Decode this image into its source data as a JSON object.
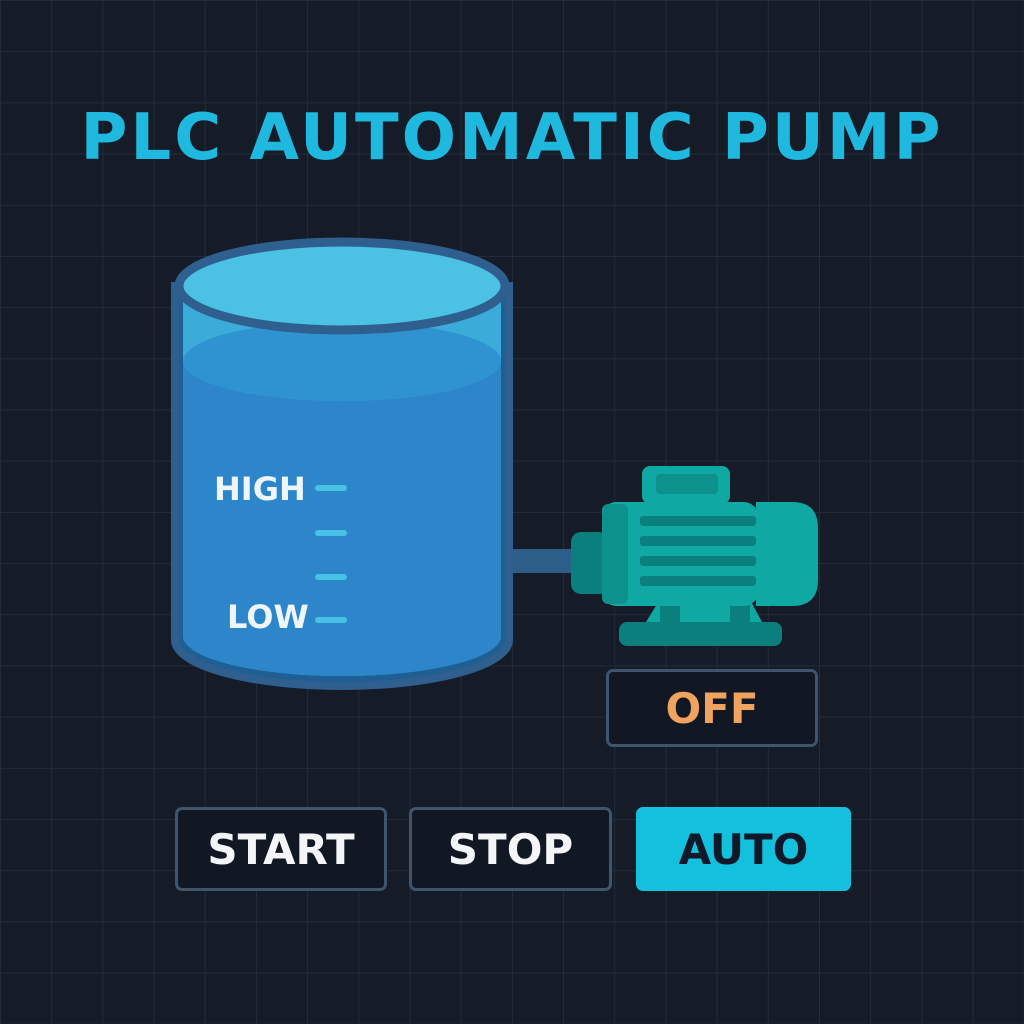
{
  "header": {
    "title": "PLC AUTOMATIC PUMP"
  },
  "tank": {
    "high_label": "HIGH",
    "low_label": "LOW",
    "level": 0.82
  },
  "pump": {
    "status": "OFF"
  },
  "controls": {
    "start_label": "START",
    "stop_label": "STOP",
    "auto_label": "AUTO",
    "active_mode": "auto"
  },
  "colors": {
    "background": "#151b27",
    "grid": "#232c3b",
    "title": "#1fb8df",
    "water": "#2c86c9",
    "water_surface": "#2f93d2",
    "tank_glass": "#4bbee0",
    "tank_outline": "#2f5f8f",
    "pump_body": "#10a8a3",
    "pump_dark": "#0a7f7e",
    "status_off": "#f0a35e",
    "auto_active": "#13c1df",
    "auto_text": "#0e1a2a",
    "tick": "#47c2e6"
  },
  "icons": {
    "tank": "water-tank-icon",
    "pump": "electric-pump-motor-icon"
  }
}
